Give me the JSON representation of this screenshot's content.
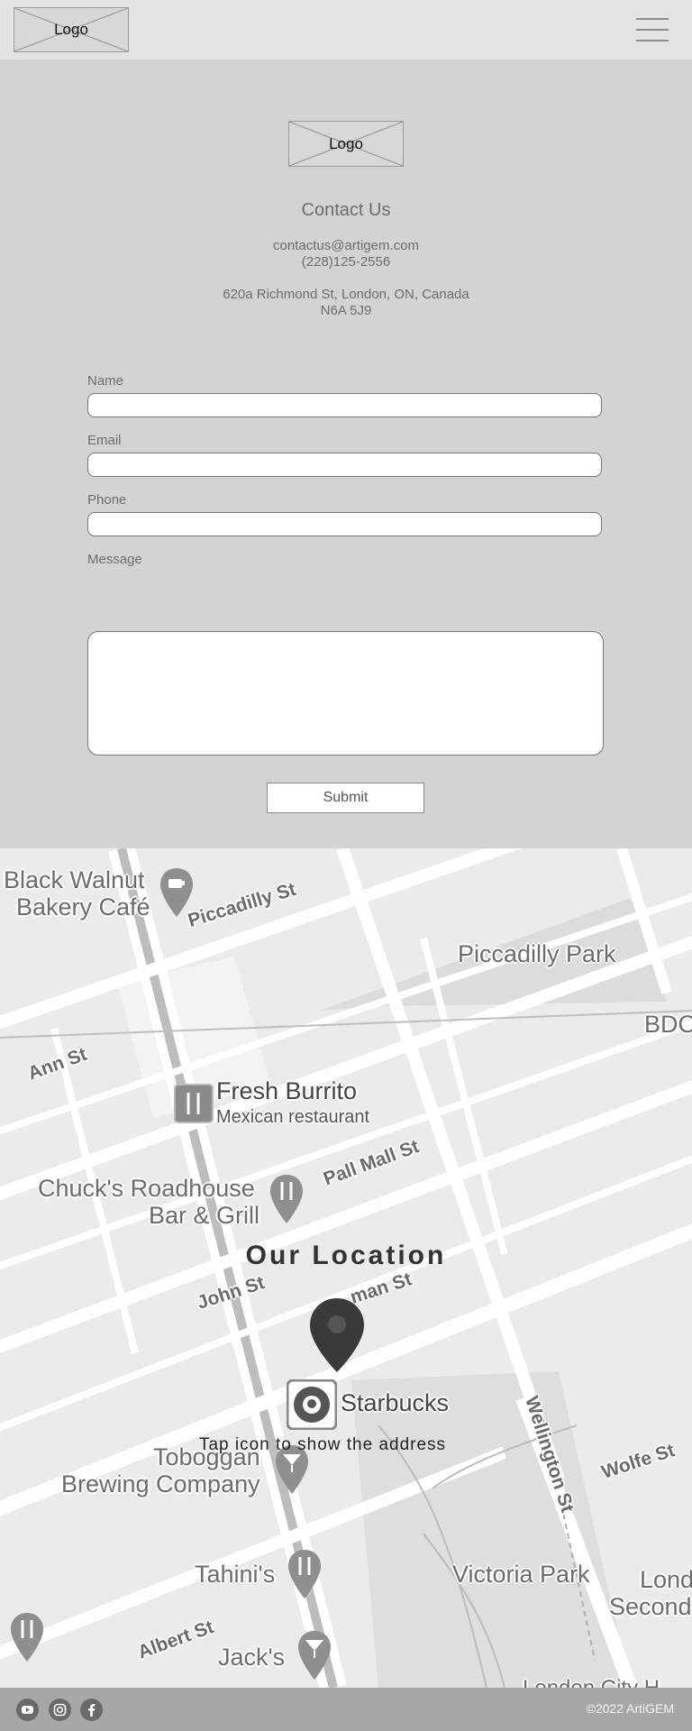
{
  "header": {
    "logo_label": "Logo",
    "menu_icon": "hamburger-menu-icon"
  },
  "contact": {
    "logo_label": "Logo",
    "title": "Contact Us",
    "email": "contactus@artigem.com",
    "phone": "(228)125-2556",
    "address_line1": "620a Richmond St, London, ON, Canada",
    "address_line2": "N6A 5J9"
  },
  "form": {
    "name_label": "Name",
    "email_label": "Email",
    "phone_label": "Phone",
    "message_label": "Message",
    "submit_label": "Submit",
    "scroll_top_icon": "chevron-up-icon"
  },
  "map": {
    "heading": "Our Location",
    "hint": "Tap icon to show the address",
    "places": {
      "black_walnut": "Black Walnut",
      "black_walnut_2": "Bakery Café",
      "piccadilly_park": "Piccadilly Park",
      "bdo": "BDO",
      "fresh_burrito": "Fresh Burrito",
      "fresh_burrito_sub": "Mexican restaurant",
      "chucks": "Chuck's Roadhouse",
      "chucks_2": "Bar & Grill",
      "starbucks": "Starbucks",
      "toboggan": "Toboggan",
      "toboggan_2": "Brewing Company",
      "tahinis": "Tahini's",
      "victoria_park": "Victoria Park",
      "london_second": "Lond",
      "london_second_2": "Second",
      "jacks": "Jack's",
      "london_city": "London City H"
    },
    "streets": {
      "piccadilly": "Piccadilly St",
      "ann": "Ann St",
      "pall_mall": "Pall Mall St",
      "john": "John St",
      "kent": "man St",
      "wellington": "Wellington St",
      "wolfe": "Wolfe St",
      "albert": "Albert St"
    }
  },
  "footer": {
    "icons": [
      "youtube-icon",
      "instagram-icon",
      "facebook-icon"
    ],
    "copyright": "©2022 ArtiGEM"
  }
}
